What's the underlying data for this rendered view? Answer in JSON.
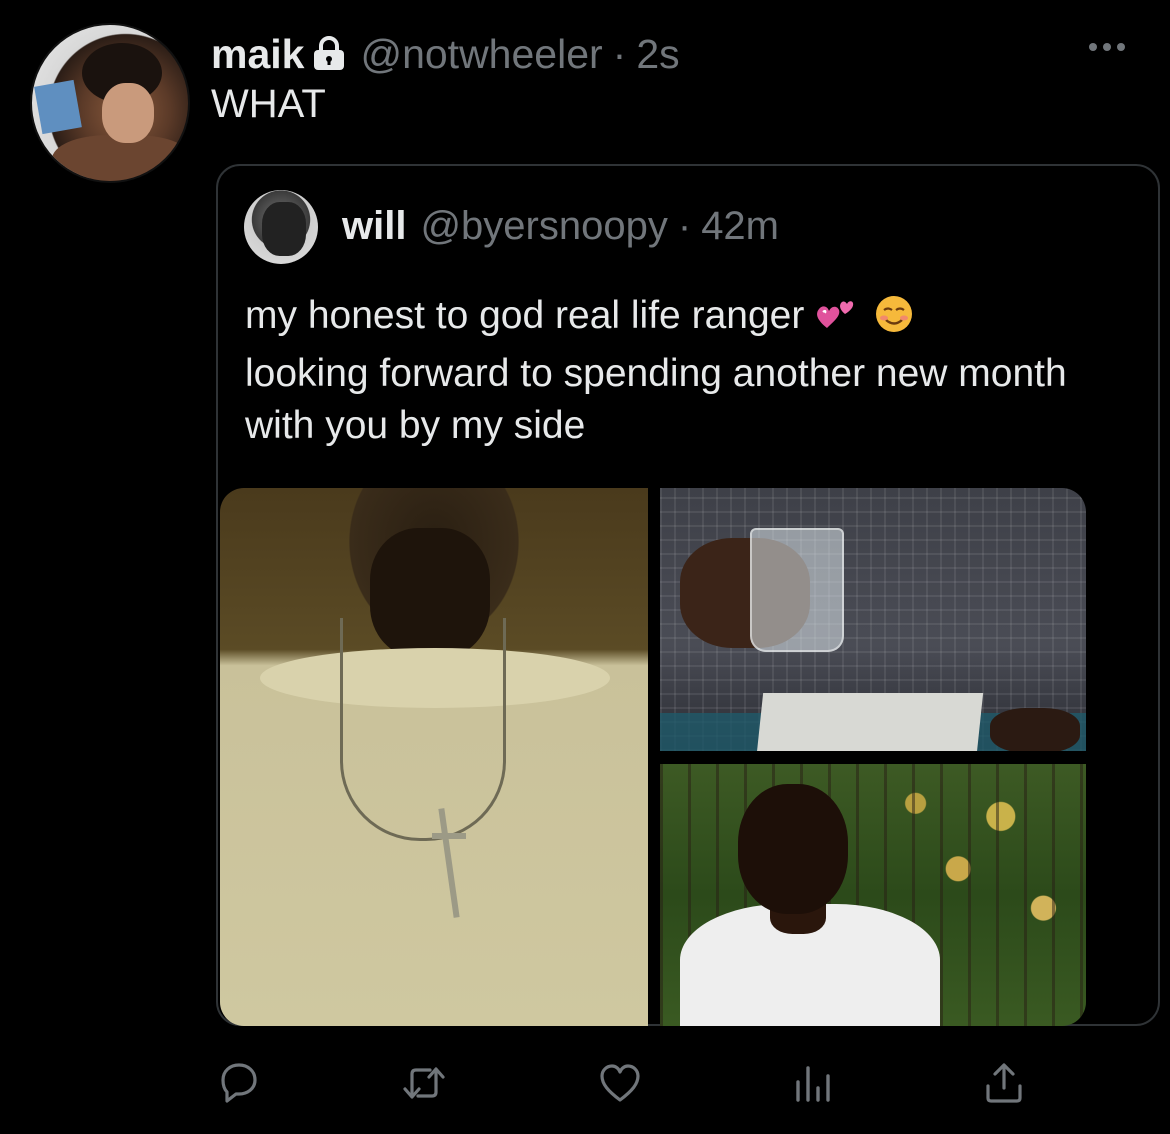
{
  "tweet": {
    "author_name": "maik",
    "author_handle": "@notwheeler",
    "separator": "·",
    "time": "2s",
    "text": "WHAT",
    "icons": {
      "avatar": "avatar",
      "lock": "lock-icon",
      "more": "more-icon"
    }
  },
  "quoted_tweet": {
    "author_name": "will",
    "author_handle": "@byersnoopy",
    "separator": "·",
    "time": "42m",
    "text_line1": "my honest to god real life ranger",
    "emoji_1": "💕",
    "emoji_2": "☺️",
    "text_rest": "looking forward to spending another new month with you by my side",
    "images": [
      "necklace-photo",
      "glass-of-water-photo",
      "garden-portrait-photo"
    ]
  },
  "actions": {
    "icons": [
      "reply-icon",
      "retweet-icon",
      "like-icon",
      "analytics-icon",
      "share-icon"
    ]
  },
  "colors": {
    "background": "#000000",
    "text": "#e7e9ea",
    "secondary": "#71767b",
    "border": "#2f3336"
  }
}
